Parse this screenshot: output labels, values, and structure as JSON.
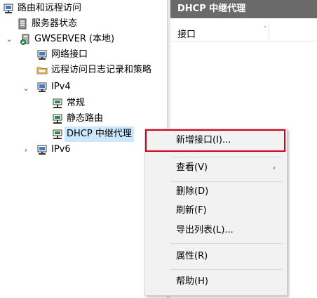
{
  "tree": {
    "items": [
      {
        "label": "路由和远程访问",
        "icon": "monitor-icon"
      },
      {
        "label": "服务器状态",
        "icon": "server-icon"
      },
      {
        "label": "GWSERVER (本地)",
        "icon": "server-icon",
        "toggle": "chevron-down-icon"
      },
      {
        "label": "网络接口",
        "icon": "monitor-icon"
      },
      {
        "label": "远程访问日志记录和策略",
        "icon": "folder-icon"
      },
      {
        "label": "IPv4",
        "icon": "monitor-icon",
        "toggle": "chevron-down-icon"
      },
      {
        "label": "常规",
        "icon": "network-icon"
      },
      {
        "label": "静态路由",
        "icon": "network-icon"
      },
      {
        "label": "DHCP 中继代理",
        "icon": "network-icon",
        "selected": true
      },
      {
        "label": "IPv6",
        "icon": "monitor-icon",
        "toggle": "chevron-right-icon"
      }
    ]
  },
  "right_pane": {
    "title": "DHCP 中继代理",
    "column_header": "接口"
  },
  "context_menu": {
    "items": [
      {
        "label": "新增接口(I)...",
        "highlighted": true
      },
      {
        "label": "查看(V)",
        "submenu": true
      },
      {
        "label": "删除(D)"
      },
      {
        "label": "刷新(F)"
      },
      {
        "label": "导出列表(L)..."
      },
      {
        "label": "属性(R)"
      },
      {
        "label": "帮助(H)"
      }
    ]
  },
  "colors": {
    "selection": "#cce8ff",
    "header_bg": "#6a6a6a",
    "highlight_border": "#d9001b",
    "menu_bg": "#f2f2f2"
  }
}
